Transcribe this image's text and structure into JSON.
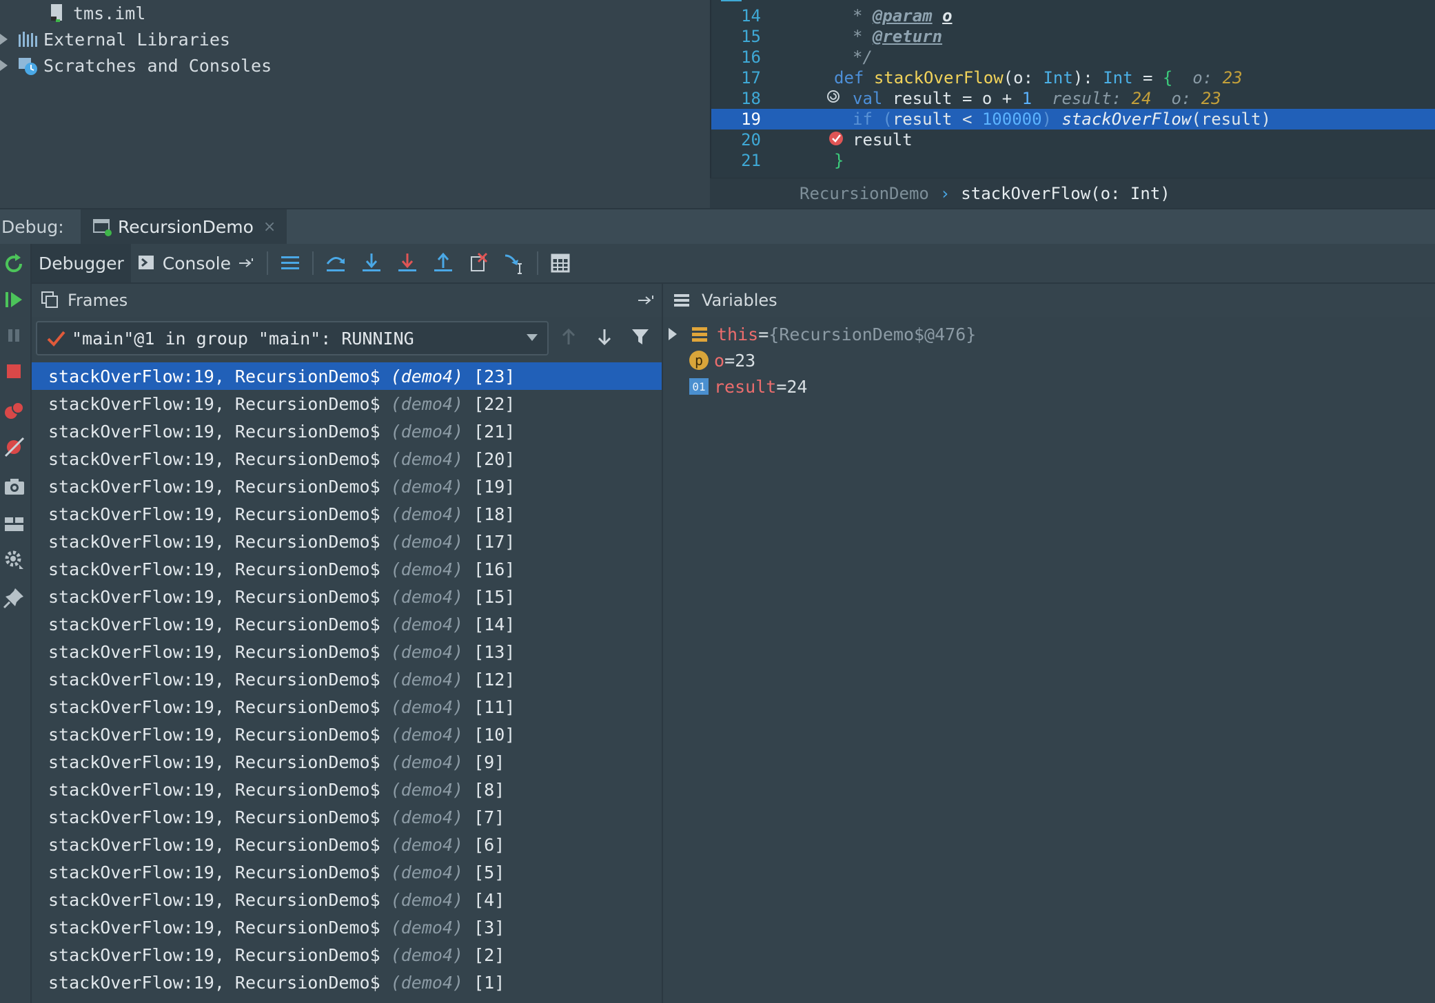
{
  "project_tree": {
    "items": [
      {
        "label": "tms.iml",
        "expandable": false,
        "icon": "file-icon"
      },
      {
        "label": "External Libraries",
        "expandable": true,
        "icon": "library-icon"
      },
      {
        "label": "Scratches and Consoles",
        "expandable": true,
        "icon": "scratches-icon"
      }
    ]
  },
  "editor": {
    "lines": [
      {
        "num": "14",
        "doc_prefix": "* ",
        "tag": "@param",
        "doc_suffix": " ",
        "param": "o"
      },
      {
        "num": "15",
        "doc_prefix": "* ",
        "tag": "@return"
      },
      {
        "num": "16",
        "doc_prefix": "*/"
      },
      {
        "num": "17",
        "kw": "def",
        "fn": "stackOverFlow",
        "paren_open": "(",
        "param": "o",
        "colon": ": ",
        "type1": "Int",
        "close": "): ",
        "type2": "Int",
        "eq": " = ",
        "brace": "{",
        "hint_name": "o:",
        "hint_val": "23"
      },
      {
        "num": "18",
        "kw": "val",
        "body": " result = o + ",
        "num_lit": "1",
        "hint1_name": "result:",
        "hint1_val": "24",
        "hint2_name": "o:",
        "hint2_val": "23"
      },
      {
        "num": "19",
        "kw": "if",
        "cond_open": " (",
        "cond": "result < ",
        "num_lit": "100000",
        "cond_close": ") ",
        "call": "stackOverFlow",
        "args": "(result)"
      },
      {
        "num": "20",
        "body": "result"
      },
      {
        "num": "21",
        "brace": "}"
      }
    ],
    "current_line": "19"
  },
  "breadcrumb": {
    "parent": "RecursionDemo",
    "separator": "›",
    "current": "stackOverFlow(o: Int)"
  },
  "debug_bar": {
    "label": "Debug:",
    "run_tab": "RecursionDemo"
  },
  "toolbar": {
    "debugger_tab": "Debugger",
    "console_tab": "Console"
  },
  "frames": {
    "title": "Frames",
    "thread": "\"main\"@1 in group \"main\": RUNNING",
    "items": [
      {
        "method": "stackOverFlow:19, RecursionDemo$ ",
        "pkg": "(demo4)",
        "index": " [23]"
      },
      {
        "method": "stackOverFlow:19, RecursionDemo$ ",
        "pkg": "(demo4)",
        "index": " [22]"
      },
      {
        "method": "stackOverFlow:19, RecursionDemo$ ",
        "pkg": "(demo4)",
        "index": " [21]"
      },
      {
        "method": "stackOverFlow:19, RecursionDemo$ ",
        "pkg": "(demo4)",
        "index": " [20]"
      },
      {
        "method": "stackOverFlow:19, RecursionDemo$ ",
        "pkg": "(demo4)",
        "index": " [19]"
      },
      {
        "method": "stackOverFlow:19, RecursionDemo$ ",
        "pkg": "(demo4)",
        "index": " [18]"
      },
      {
        "method": "stackOverFlow:19, RecursionDemo$ ",
        "pkg": "(demo4)",
        "index": " [17]"
      },
      {
        "method": "stackOverFlow:19, RecursionDemo$ ",
        "pkg": "(demo4)",
        "index": " [16]"
      },
      {
        "method": "stackOverFlow:19, RecursionDemo$ ",
        "pkg": "(demo4)",
        "index": " [15]"
      },
      {
        "method": "stackOverFlow:19, RecursionDemo$ ",
        "pkg": "(demo4)",
        "index": " [14]"
      },
      {
        "method": "stackOverFlow:19, RecursionDemo$ ",
        "pkg": "(demo4)",
        "index": " [13]"
      },
      {
        "method": "stackOverFlow:19, RecursionDemo$ ",
        "pkg": "(demo4)",
        "index": " [12]"
      },
      {
        "method": "stackOverFlow:19, RecursionDemo$ ",
        "pkg": "(demo4)",
        "index": " [11]"
      },
      {
        "method": "stackOverFlow:19, RecursionDemo$ ",
        "pkg": "(demo4)",
        "index": " [10]"
      },
      {
        "method": "stackOverFlow:19, RecursionDemo$ ",
        "pkg": "(demo4)",
        "index": " [9]"
      },
      {
        "method": "stackOverFlow:19, RecursionDemo$ ",
        "pkg": "(demo4)",
        "index": " [8]"
      },
      {
        "method": "stackOverFlow:19, RecursionDemo$ ",
        "pkg": "(demo4)",
        "index": " [7]"
      },
      {
        "method": "stackOverFlow:19, RecursionDemo$ ",
        "pkg": "(demo4)",
        "index": " [6]"
      },
      {
        "method": "stackOverFlow:19, RecursionDemo$ ",
        "pkg": "(demo4)",
        "index": " [5]"
      },
      {
        "method": "stackOverFlow:19, RecursionDemo$ ",
        "pkg": "(demo4)",
        "index": " [4]"
      },
      {
        "method": "stackOverFlow:19, RecursionDemo$ ",
        "pkg": "(demo4)",
        "index": " [3]"
      },
      {
        "method": "stackOverFlow:19, RecursionDemo$ ",
        "pkg": "(demo4)",
        "index": " [2]"
      },
      {
        "method": "stackOverFlow:19, RecursionDemo$ ",
        "pkg": "(demo4)",
        "index": " [1]"
      }
    ]
  },
  "variables": {
    "title": "Variables",
    "items": [
      {
        "name": "this",
        "eq": " = ",
        "value": "{RecursionDemo$@476}",
        "icon": "object-icon",
        "expandable": true
      },
      {
        "name": "o",
        "eq": " = ",
        "value": "23",
        "icon": "parameter-icon",
        "icon_letter": "p",
        "expandable": false
      },
      {
        "name": "result",
        "eq": " = ",
        "value": "24",
        "icon": "local-var-icon",
        "icon_letter": "01",
        "expandable": false
      }
    ]
  },
  "colors": {
    "selection": "#2160b8",
    "breakpoint": "#e05555",
    "resume_green": "#4cc45a",
    "stop_red": "#d94848",
    "step_blue": "#4aa8e6"
  }
}
